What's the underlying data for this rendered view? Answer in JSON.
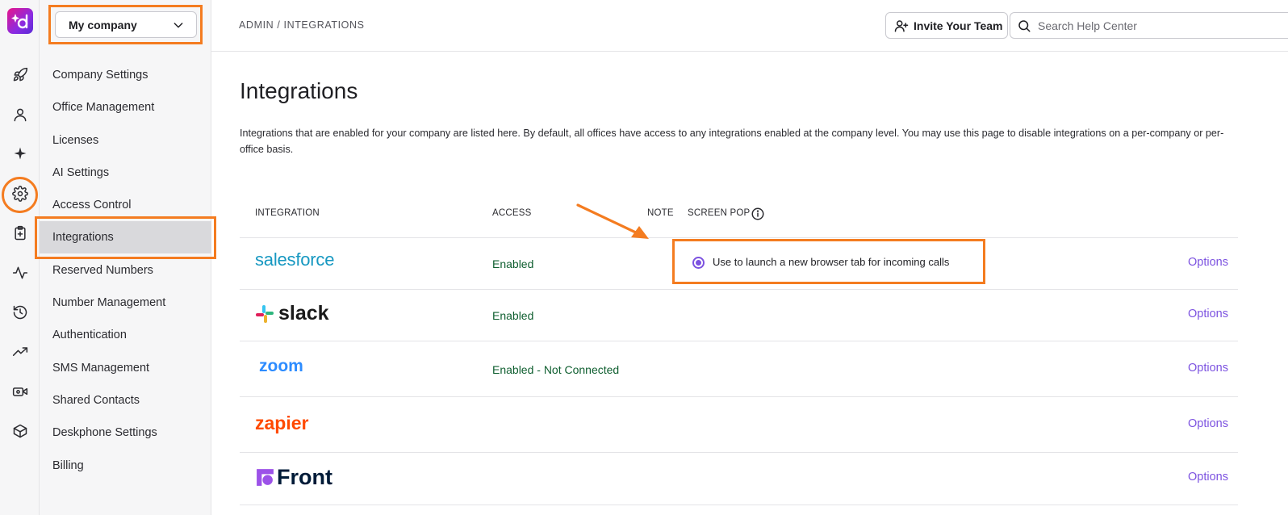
{
  "app": {
    "brand_color": "#e9158a",
    "accent_color": "#7c52e0",
    "highlight_color": "#f47c20",
    "logo_icon": "dialpad-logo-icon"
  },
  "rail": {
    "icons": [
      "rocket-icon",
      "user-icon",
      "sparkle-icon",
      "gear-icon",
      "clipboard-plus-icon",
      "activity-icon",
      "history-icon",
      "trending-icon",
      "video-icon",
      "box-icon"
    ]
  },
  "sidebar": {
    "company_select": "My company",
    "items": [
      {
        "label": "Company Settings"
      },
      {
        "label": "Office Management"
      },
      {
        "label": "Licenses"
      },
      {
        "label": "AI Settings"
      },
      {
        "label": "Access Control"
      },
      {
        "label": "Integrations"
      },
      {
        "label": "Reserved Numbers"
      },
      {
        "label": "Number Management"
      },
      {
        "label": "Authentication"
      },
      {
        "label": "SMS Management"
      },
      {
        "label": "Shared Contacts"
      },
      {
        "label": "Deskphone Settings"
      },
      {
        "label": "Billing"
      }
    ]
  },
  "header": {
    "breadcrumb": "ADMIN / INTEGRATIONS",
    "invite_label": "Invite Your Team",
    "search_placeholder": "Search Help Center"
  },
  "main": {
    "title": "Integrations",
    "description": "Integrations that are enabled for your company are listed here. By default, all offices have access to any integrations enabled at the company level. You may use this page to disable integrations on a per-company or per-office basis.",
    "columns": {
      "integration": "INTEGRATION",
      "access": "ACCESS",
      "note": "NOTE",
      "screen_pop": "SCREEN POP"
    },
    "rows": [
      {
        "name": "salesforce",
        "access": "Enabled",
        "options": "Options"
      },
      {
        "name": "slack",
        "access": "Enabled",
        "options": "Options"
      },
      {
        "name": "zoom",
        "access": "Enabled - Not Connected",
        "options": "Options"
      },
      {
        "name": "zapier",
        "access": "",
        "options": "Options"
      },
      {
        "name": "Front",
        "access": "",
        "options": "Options"
      }
    ],
    "screen_pop_label": "Use to launch a new browser tab for incoming calls"
  }
}
